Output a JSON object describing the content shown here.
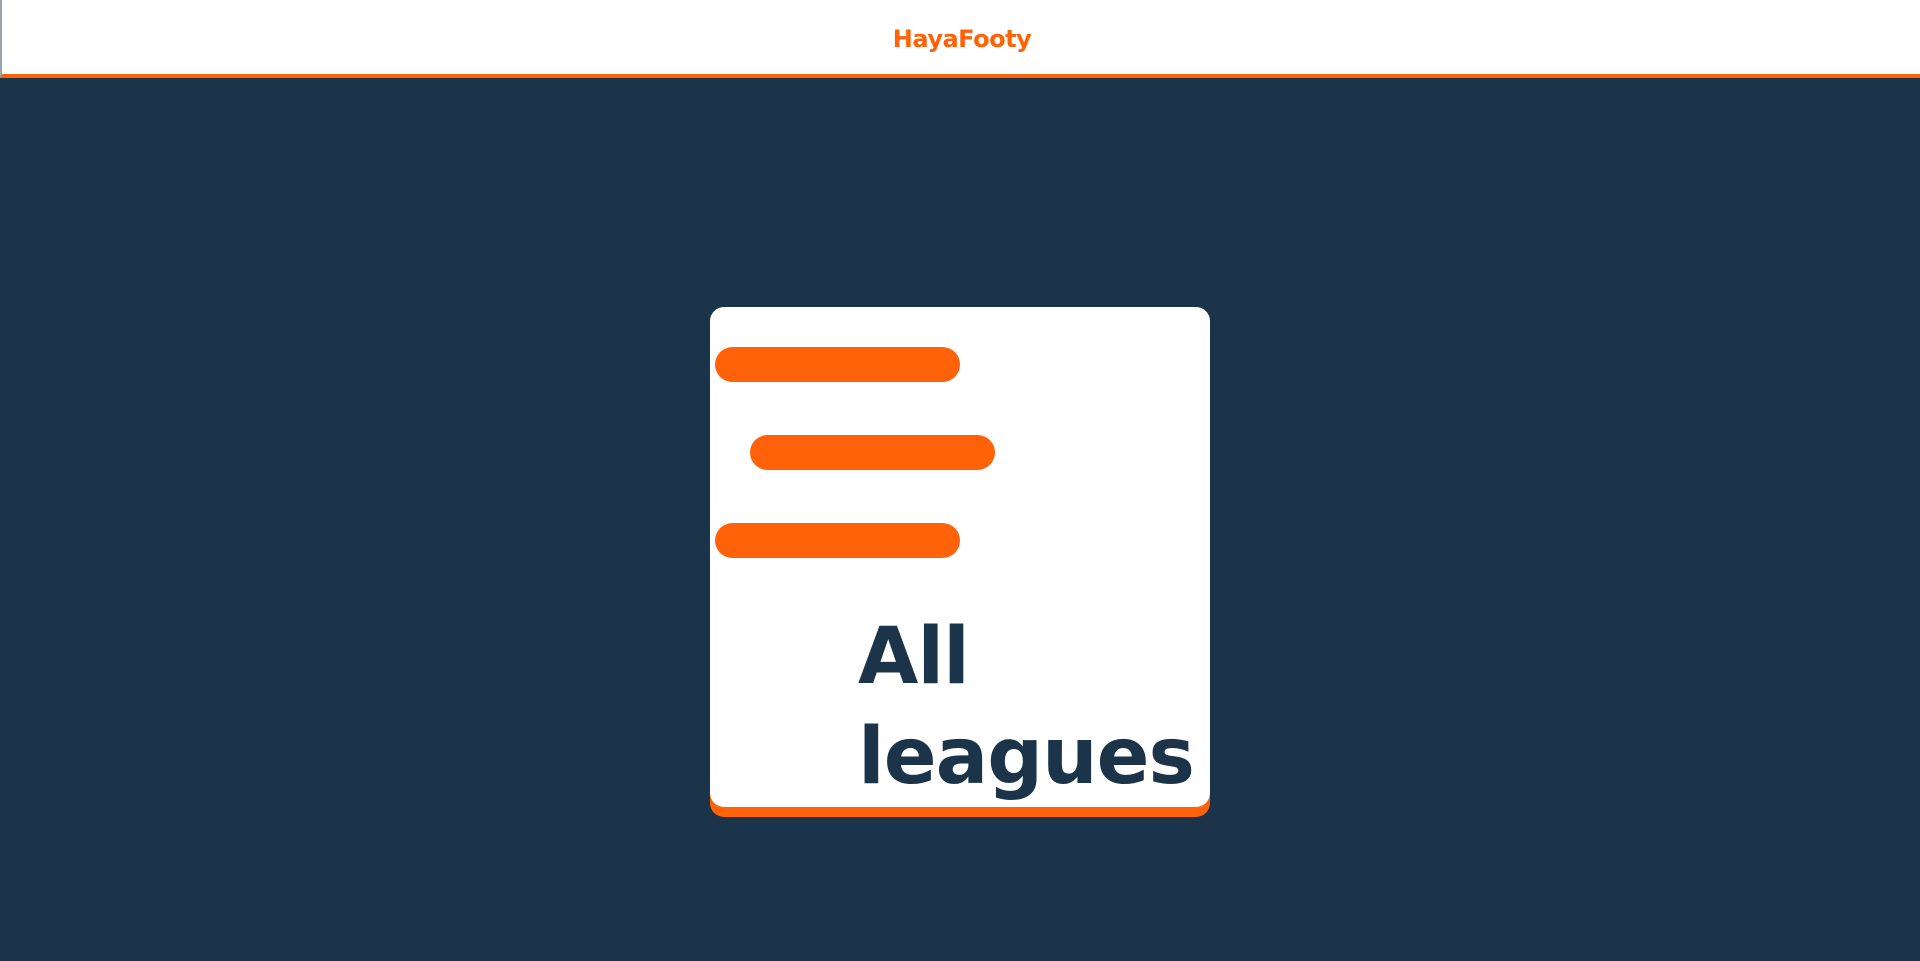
{
  "header": {
    "brand": "HayaFooty",
    "brand_color": "#ff6208",
    "accent_color": "#ff6208"
  },
  "main": {
    "background_color": "#1b3449",
    "card": {
      "icon": "menu-lines-icon",
      "label": "All leagues",
      "bar_color": "#ff6208",
      "text_color": "#1b3449"
    }
  }
}
